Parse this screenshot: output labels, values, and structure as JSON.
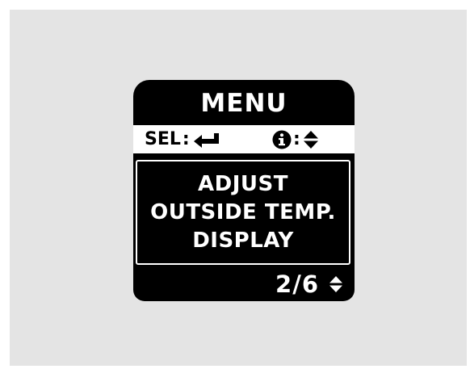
{
  "screen": {
    "title": "MENU",
    "hints": {
      "select_label": "SEL",
      "select_sep": ":",
      "select_icon": "enter-arrow-icon",
      "info_icon": "info-icon",
      "info_sep": ":",
      "info_arrows_icon": "up-down-arrows-icon"
    },
    "content": {
      "lines": [
        "ADJUST",
        "OUTSIDE TEMP.",
        "DISPLAY"
      ]
    },
    "footer": {
      "page_indicator": "2/6",
      "scroll_icon": "up-down-arrows-icon"
    }
  },
  "colors": {
    "screen_background": "#000000",
    "screen_text": "#ffffff",
    "hint_bar_background": "#ffffff",
    "page_background": "#e4e4e4"
  }
}
